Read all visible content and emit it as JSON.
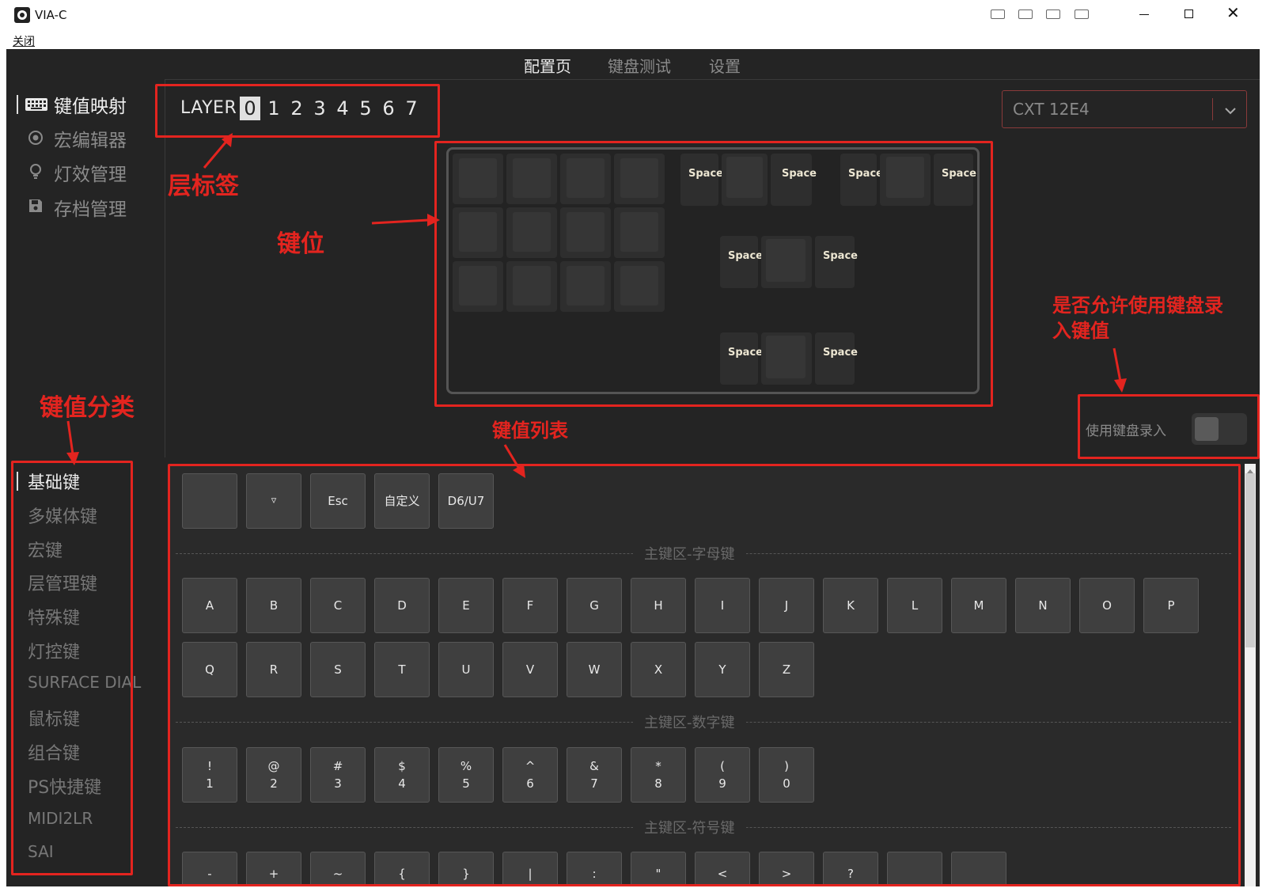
{
  "window": {
    "title": "VIA-C",
    "menu_close": "关闭",
    "close_glyph": "✕"
  },
  "top_tabs": [
    {
      "label": "配置页"
    },
    {
      "label": "键盘测试"
    },
    {
      "label": "设置"
    }
  ],
  "nav": {
    "items": [
      {
        "label": "键值映射",
        "icon": "keyboard-icon"
      },
      {
        "label": "宏编辑器",
        "icon": "record-icon"
      },
      {
        "label": "灯效管理",
        "icon": "bulb-icon"
      },
      {
        "label": "存档管理",
        "icon": "floppy-icon"
      }
    ]
  },
  "layers": {
    "label": "LAYER",
    "numbers": [
      "0",
      "1",
      "2",
      "3",
      "4",
      "5",
      "6",
      "7"
    ],
    "active": "0"
  },
  "device": {
    "name": "CXT 12E4"
  },
  "keyboard": {
    "space_label": "Space"
  },
  "annotations": {
    "layer_tag": "层标签",
    "key_position": "键位",
    "allow_kb_entry_line1": "是否允许使用键盘录",
    "allow_kb_entry_line2": "入键值",
    "key_category": "键值分类",
    "key_list": "键值列表"
  },
  "kb_entry": {
    "label": "使用键盘录入",
    "enabled": false
  },
  "categories": [
    {
      "label": "基础键"
    },
    {
      "label": "多媒体键"
    },
    {
      "label": "宏键"
    },
    {
      "label": "层管理键"
    },
    {
      "label": "特殊键"
    },
    {
      "label": "灯控键"
    },
    {
      "label": "SURFACE DIAL"
    },
    {
      "label": "鼠标键"
    },
    {
      "label": "组合键"
    },
    {
      "label": "PS快捷键"
    },
    {
      "label": "MIDI2LR"
    },
    {
      "label": "SAI"
    }
  ],
  "key_list": {
    "top_row": [
      "",
      "▿",
      "Esc",
      "自定义",
      "D6/U7"
    ],
    "letters_section": "主键区-字母键",
    "letters_row1": [
      "A",
      "B",
      "C",
      "D",
      "E",
      "F",
      "G",
      "H",
      "I",
      "J",
      "K",
      "L",
      "M",
      "N",
      "O",
      "P"
    ],
    "letters_row2": [
      "Q",
      "R",
      "S",
      "T",
      "U",
      "V",
      "W",
      "X",
      "Y",
      "Z"
    ],
    "numbers_section": "主键区-数字键",
    "numbers_top": [
      "!",
      "@",
      "#",
      "$",
      "%",
      "^",
      "&",
      "*",
      "(",
      ")"
    ],
    "numbers_bottom": [
      "1",
      "2",
      "3",
      "4",
      "5",
      "6",
      "7",
      "8",
      "9",
      "0"
    ],
    "symbols_section": "主键区-符号键",
    "symbols_row": [
      "-",
      "+",
      "~",
      "{",
      "}",
      "|",
      ":",
      "\"",
      "<",
      ">",
      "?",
      "",
      ""
    ]
  }
}
